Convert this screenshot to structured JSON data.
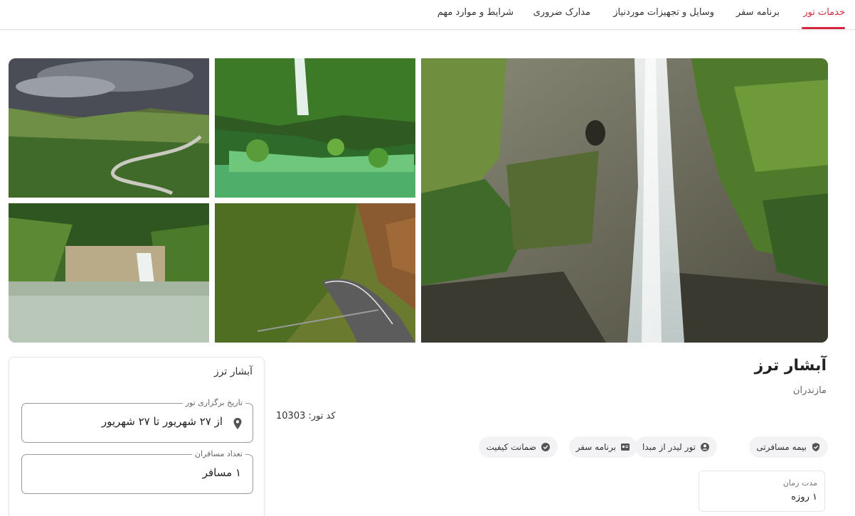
{
  "nav": {
    "tabs": [
      {
        "label": "خدمات تور",
        "active": true
      },
      {
        "label": "برنامه سفر",
        "active": false
      },
      {
        "label": "وسایل و تجهیزات موردنیاز",
        "active": false
      },
      {
        "label": "مدارک ضروری",
        "active": false
      },
      {
        "label": "شرایط و موارد مهم",
        "active": false
      }
    ],
    "accent_color": "#d7263d"
  },
  "gallery": {
    "photos": [
      {
        "subject": "waterfall-cliff"
      },
      {
        "subject": "green-canyon-stream"
      },
      {
        "subject": "stormy-mountain-road"
      },
      {
        "subject": "forest-road-autumn"
      },
      {
        "subject": "small-waterfall-pool"
      }
    ]
  },
  "tour": {
    "title": "آبشار ترز",
    "region": "مازندران",
    "code_text": "کد تور: 10303",
    "features": [
      {
        "label": "بیمه مسافرتی",
        "icon": "shield-check-icon"
      },
      {
        "label": "تور لیدر از مبدا",
        "icon": "person-icon"
      },
      {
        "label": "برنامه سفر",
        "icon": "itinerary-icon"
      },
      {
        "label": "ضمانت کیفیت",
        "icon": "check-circle-icon"
      }
    ],
    "duration": {
      "label": "مدت زمان",
      "value": "۱ روزه"
    }
  },
  "booking": {
    "title": "آبشار ترز",
    "date_legend": "تاریخ برگزاری تور",
    "date_value": "از ۲۷ شهریور تا ۲۷ شهریور",
    "travelers_legend": "تعداد مسافران",
    "travelers_value": "۱ مسافر"
  }
}
